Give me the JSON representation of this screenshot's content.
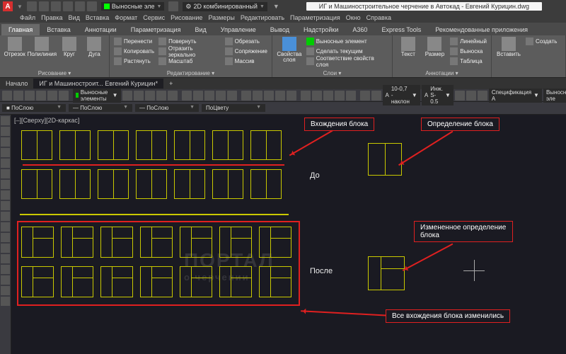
{
  "title": "ИГ и Машиностроительное черчение в Автокад - Евгений Курицин.dwg",
  "qat_combo1": "Выносные эле",
  "qat_combo2": "2D комбинированный",
  "menu": [
    "Файл",
    "Правка",
    "Вид",
    "Вставка",
    "Формат",
    "Сервис",
    "Рисование",
    "Размеры",
    "Редактировать",
    "Параметризация",
    "Окно",
    "Справка"
  ],
  "ribbon_tabs": [
    "Главная",
    "Вставка",
    "Аннотации",
    "Параметризация",
    "Вид",
    "Управление",
    "Вывод",
    "Надстройки",
    "A360",
    "Express Tools",
    "Рекомендованные приложения"
  ],
  "panels": {
    "draw": {
      "label": "Рисование ▾",
      "btns": [
        "Отрезок",
        "Полилиния",
        "Круг",
        "Дуга"
      ]
    },
    "modify": {
      "label": "Редактирование ▾",
      "items": [
        "Перенести",
        "Копировать",
        "Растянуть",
        "Повернуть",
        "Отразить зеркально",
        "Масштаб",
        "Обрезать",
        "Сопряжение",
        "Массив"
      ]
    },
    "layers": {
      "label": "Слои ▾",
      "big": "Свойства слоя",
      "items": [
        "Выносные элемент",
        "Сделать текущим",
        "Соответствие свойств слоя"
      ]
    },
    "annot": {
      "label": "Аннотации ▾",
      "big": [
        "Текст",
        "Размер"
      ],
      "items": [
        "Линейный",
        "Выноска",
        "Таблица"
      ]
    },
    "block": {
      "label": "",
      "items": [
        "Вставить",
        "Создать"
      ]
    }
  },
  "file_tabs": [
    "Начало",
    "ИГ и Машиностроит... Евгений Курицин*"
  ],
  "toolbar2_combo": "Выносные элементы",
  "toolbar2_textstyle": "10-0,7 - наклон",
  "toolbar2_dimstyle": "Инж. S-0.5",
  "toolbar2_tbl": "Спецификация А",
  "toolbar2_ml": "Выносные эле",
  "layer_combos": [
    "ПоСлою",
    "ПоСлою",
    "ПоСлою",
    "ПоЦвету"
  ],
  "viewlabel": "[–][Сверху][2D-каркас]",
  "callouts": {
    "c1": "Вхождения блока",
    "c2": "Определение блока",
    "c3": "Измененное определение блока",
    "c4": "Все вхождения блока изменились"
  },
  "labels": {
    "before": "До",
    "after": "После"
  },
  "watermark": "ПОРТАЛ",
  "watermark2": "о черчении"
}
